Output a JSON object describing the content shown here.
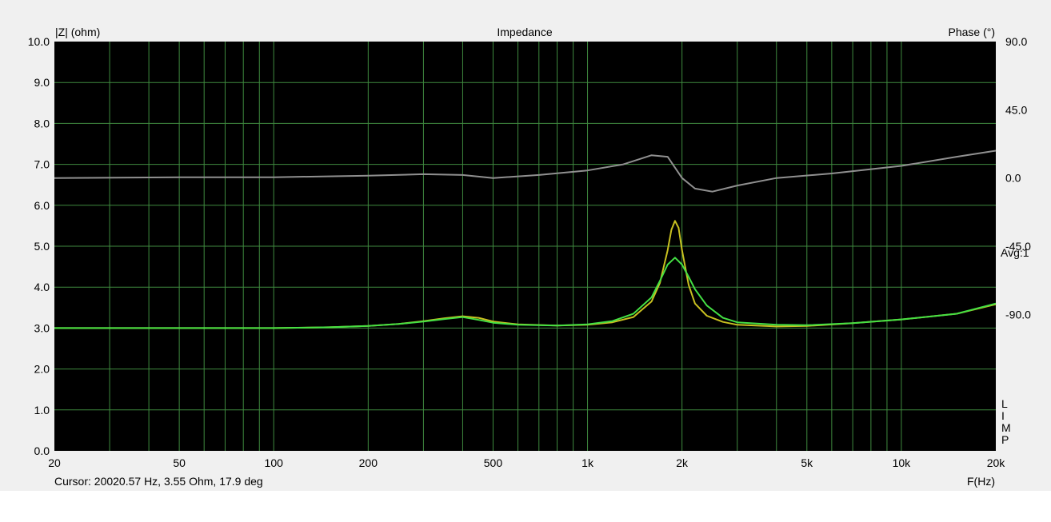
{
  "chart_data": {
    "type": "line",
    "title": "Impedance",
    "ylabel_left": "|Z| (ohm)",
    "ylabel_right": "Phase (°)",
    "xlabel": "F(Hz)",
    "x_scale": "log",
    "xlim": [
      20,
      20000
    ],
    "ylim_left": [
      0,
      10
    ],
    "ylim_right": [
      -180,
      90
    ],
    "x_ticks": [
      {
        "v": 20,
        "label": "20"
      },
      {
        "v": 50,
        "label": "50"
      },
      {
        "v": 100,
        "label": "100"
      },
      {
        "v": 200,
        "label": "200"
      },
      {
        "v": 500,
        "label": "500"
      },
      {
        "v": 1000,
        "label": "1k"
      },
      {
        "v": 2000,
        "label": "2k"
      },
      {
        "v": 5000,
        "label": "5k"
      },
      {
        "v": 10000,
        "label": "10k"
      },
      {
        "v": 20000,
        "label": "20k"
      }
    ],
    "y_ticks_left": [
      "0.0",
      "1.0",
      "2.0",
      "3.0",
      "4.0",
      "5.0",
      "6.0",
      "7.0",
      "8.0",
      "9.0",
      "10.0"
    ],
    "y_ticks_right": [
      {
        "v": 90,
        "label": "90.0"
      },
      {
        "v": 45,
        "label": "45.0"
      },
      {
        "v": 0,
        "label": "0.0"
      },
      {
        "v": -45,
        "label": "-45.0"
      },
      {
        "v": -90,
        "label": "-90.0"
      }
    ],
    "grid": true,
    "background": "#000000",
    "grid_color": "#3f8a3f",
    "series": [
      {
        "axis": "right",
        "color": "#909090",
        "x": [
          20,
          50,
          100,
          200,
          300,
          400,
          500,
          700,
          1000,
          1300,
          1600,
          1800,
          2000,
          2200,
          2500,
          3000,
          4000,
          6000,
          10000,
          15000,
          20000
        ],
        "y": [
          0,
          0.5,
          0.5,
          1.5,
          2.5,
          2,
          0,
          2,
          5,
          9,
          15,
          14,
          0,
          -7,
          -9,
          -5,
          0,
          3,
          8,
          14,
          18
        ]
      },
      {
        "axis": "left",
        "color": "#c8c020",
        "x": [
          20,
          100,
          150,
          200,
          250,
          300,
          350,
          400,
          450,
          500,
          600,
          800,
          1000,
          1200,
          1400,
          1600,
          1700,
          1800,
          1850,
          1900,
          1950,
          2000,
          2100,
          2200,
          2400,
          2700,
          3000,
          4000,
          5000,
          7000,
          10000,
          15000,
          20000
        ],
        "y": [
          3.0,
          3.0,
          3.02,
          3.05,
          3.1,
          3.17,
          3.24,
          3.29,
          3.25,
          3.16,
          3.09,
          3.06,
          3.08,
          3.14,
          3.27,
          3.65,
          4.1,
          4.9,
          5.4,
          5.62,
          5.45,
          4.9,
          4.05,
          3.6,
          3.3,
          3.15,
          3.08,
          3.04,
          3.05,
          3.12,
          3.21,
          3.35,
          3.58
        ]
      },
      {
        "axis": "left",
        "color": "#44e044",
        "x": [
          20,
          100,
          150,
          200,
          250,
          300,
          350,
          400,
          450,
          500,
          600,
          800,
          1000,
          1200,
          1400,
          1600,
          1700,
          1800,
          1900,
          2000,
          2100,
          2200,
          2400,
          2700,
          3000,
          4000,
          5000,
          7000,
          10000,
          15000,
          20000
        ],
        "y": [
          3.0,
          3.0,
          3.02,
          3.05,
          3.1,
          3.16,
          3.22,
          3.27,
          3.2,
          3.13,
          3.08,
          3.06,
          3.09,
          3.17,
          3.35,
          3.75,
          4.15,
          4.55,
          4.72,
          4.55,
          4.25,
          3.95,
          3.55,
          3.25,
          3.14,
          3.08,
          3.07,
          3.12,
          3.21,
          3.35,
          3.6
        ]
      }
    ],
    "annotations": {
      "avg": "Avg:1",
      "limp_letters": [
        "L",
        "I",
        "M",
        "P"
      ]
    }
  },
  "status": {
    "cursor_text": "Cursor: 20020.57 Hz, 3.55 Ohm, 17.9 deg"
  }
}
